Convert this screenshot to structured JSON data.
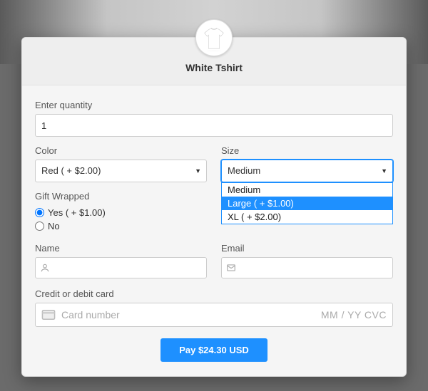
{
  "product": {
    "title": "White Tshirt"
  },
  "quantity": {
    "label": "Enter quantity",
    "value": "1"
  },
  "color": {
    "label": "Color",
    "selected": "Red ( + $2.00)"
  },
  "size": {
    "label": "Size",
    "selected": "Medium",
    "options": [
      "Medium",
      "Large ( + $1.00)",
      "XL ( + $2.00)"
    ],
    "highlighted_index": 1
  },
  "gift": {
    "label": "Gift Wrapped",
    "yes_label": "Yes ( + $1.00)",
    "no_label": "No",
    "yes_checked": true,
    "no_checked": false
  },
  "name": {
    "label": "Name"
  },
  "email": {
    "label": "Email"
  },
  "card": {
    "label": "Credit or debit card",
    "placeholder": "Card number",
    "right": "MM / YY  CVC"
  },
  "pay_button": "Pay $24.30 USD"
}
